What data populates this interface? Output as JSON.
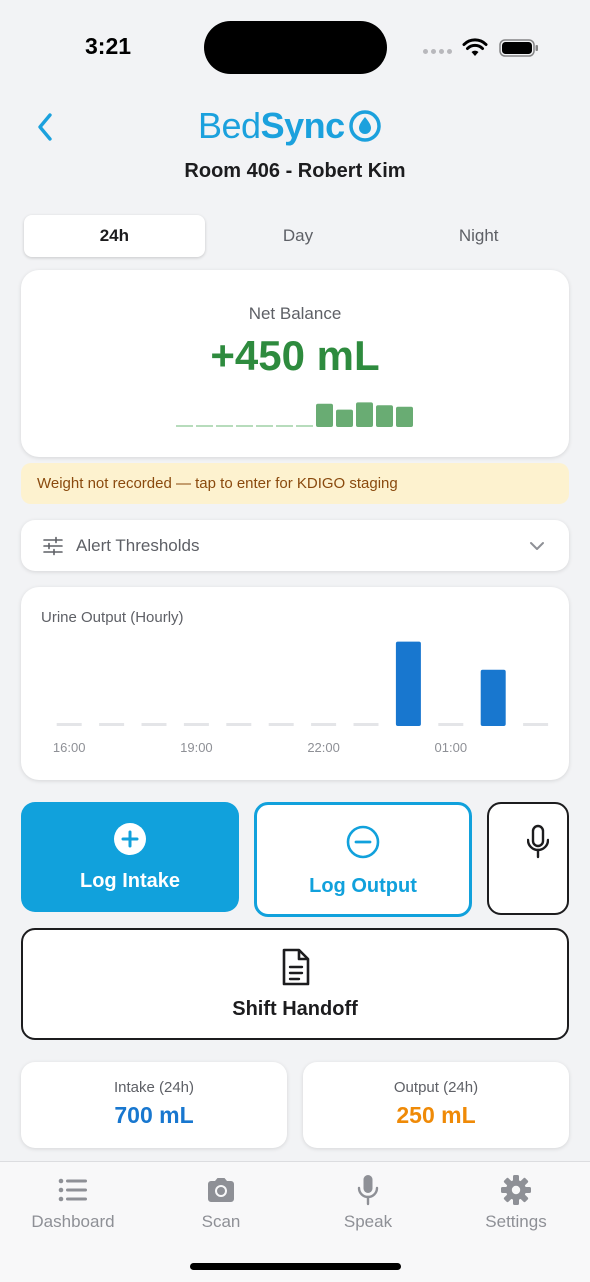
{
  "status_bar": {
    "time": "3:21"
  },
  "header": {
    "logo_part1": "Bed",
    "logo_part2": "Sync",
    "room_title": "Room 406 - Robert Kim"
  },
  "segments": [
    {
      "label": "24h",
      "active": true
    },
    {
      "label": "Day",
      "active": false
    },
    {
      "label": "Night",
      "active": false
    }
  ],
  "net_balance": {
    "label": "Net Balance",
    "value": "+450 mL",
    "sparkline_levels": [
      0,
      0,
      0,
      0,
      0,
      0,
      0,
      0.8,
      0.6,
      0.85,
      0.75,
      0.7
    ],
    "color": "#2e8b3e"
  },
  "warning": {
    "text": "Weight not recorded — tap to enter for KDIGO staging"
  },
  "alert_thresholds": {
    "label": "Alert Thresholds"
  },
  "chart_data": {
    "type": "bar",
    "title": "Urine Output (Hourly)",
    "categories": [
      "16:00",
      "17:00",
      "18:00",
      "19:00",
      "20:00",
      "21:00",
      "22:00",
      "23:00",
      "00:00",
      "01:00",
      "02:00",
      "03:00"
    ],
    "tick_labels": [
      "16:00",
      "19:00",
      "22:00",
      "01:00"
    ],
    "values": [
      0,
      0,
      0,
      0,
      0,
      0,
      0,
      0,
      150,
      0,
      100,
      0
    ],
    "ylim": [
      0,
      160
    ],
    "bar_color": "#1877cf",
    "empty_color": "#e4e5e8"
  },
  "actions": {
    "log_intake": "Log Intake",
    "log_output": "Log Output",
    "shift_handoff": "Shift Handoff"
  },
  "totals": {
    "intake_label": "Intake (24h)",
    "intake_value": "700 mL",
    "output_label": "Output (24h)",
    "output_value": "250 mL"
  },
  "tabs": [
    {
      "label": "Dashboard",
      "icon": "list-icon"
    },
    {
      "label": "Scan",
      "icon": "camera-icon"
    },
    {
      "label": "Speak",
      "icon": "microphone-icon"
    },
    {
      "label": "Settings",
      "icon": "gear-icon"
    }
  ]
}
